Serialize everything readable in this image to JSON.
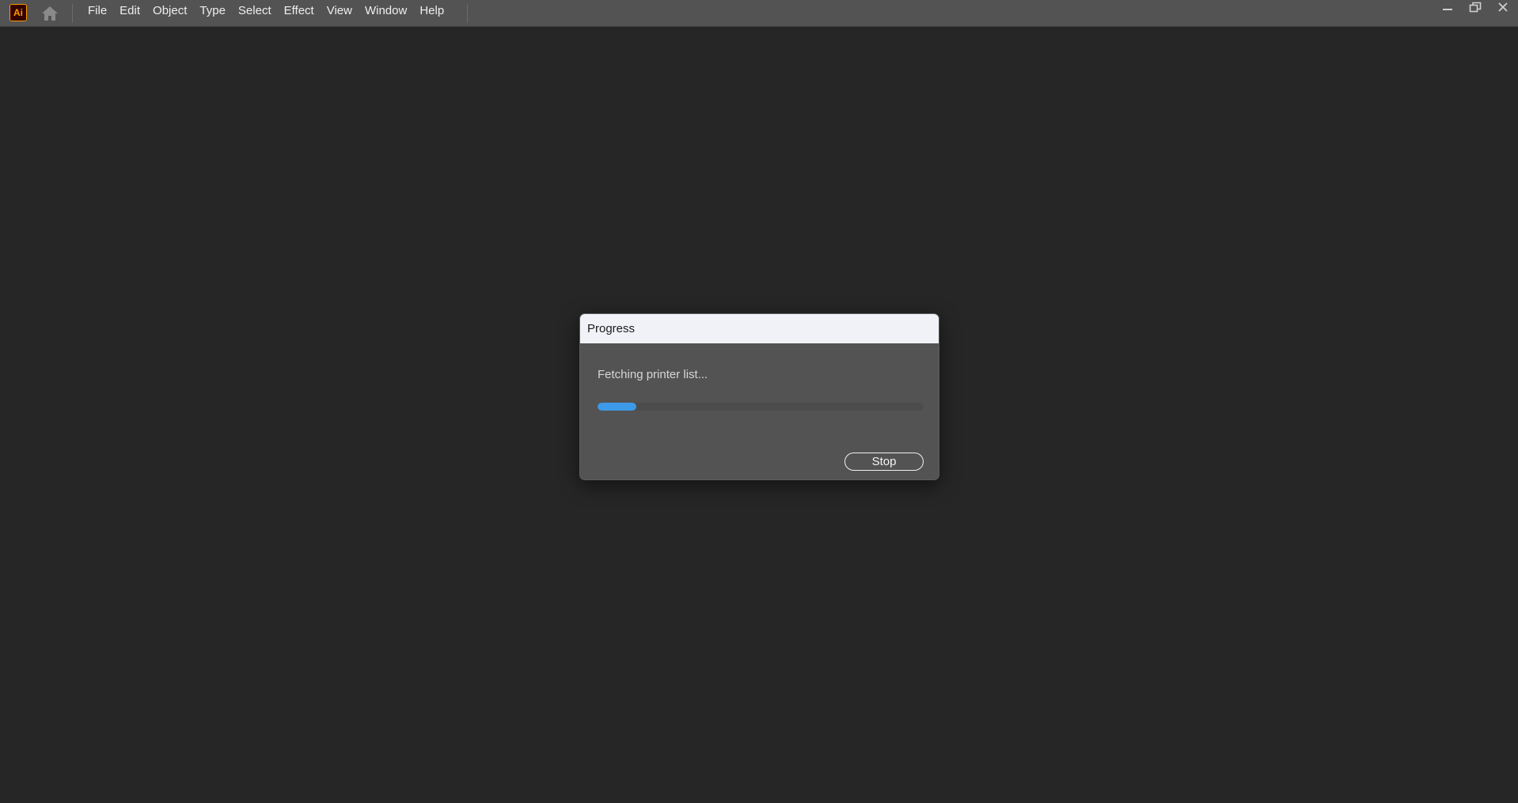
{
  "app": {
    "logo_text": "Ai",
    "brand_color": "#ff9a00"
  },
  "menubar": {
    "home_icon": "home-icon",
    "items": [
      {
        "label": "File"
      },
      {
        "label": "Edit"
      },
      {
        "label": "Object"
      },
      {
        "label": "Type"
      },
      {
        "label": "Select"
      },
      {
        "label": "Effect"
      },
      {
        "label": "View"
      },
      {
        "label": "Window"
      },
      {
        "label": "Help"
      }
    ]
  },
  "window_controls": {
    "minimize_icon": "minimize-icon",
    "restore_icon": "restore-icon",
    "close_icon": "close-icon"
  },
  "dialog": {
    "title": "Progress",
    "message": "Fetching printer list...",
    "progress_fraction": 0.12,
    "progress_color": "#3d9ae8",
    "stop_label": "Stop"
  }
}
